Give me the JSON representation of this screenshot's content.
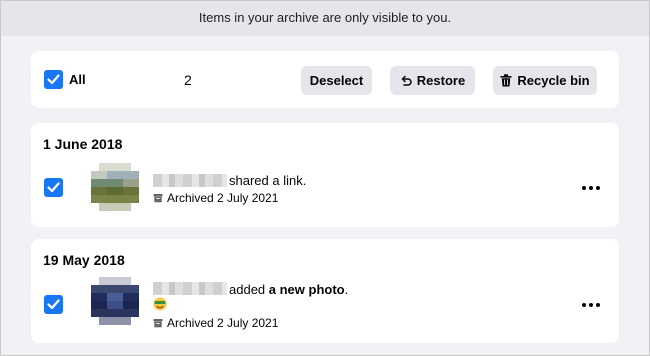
{
  "notice": {
    "text": "Items in your archive are only visible to you."
  },
  "toolbar": {
    "select_all_label": "All",
    "selected_count": "2",
    "deselect_label": "Deselect",
    "restore_label": "Restore",
    "recycle_label": "Recycle bin"
  },
  "posts": [
    {
      "date": "1 June 2018",
      "action_plain": "shared a link.",
      "action_bold": "",
      "archived": "Archived 2 July 2021",
      "checked": true,
      "avatar_icon": "blurred-photo-icon"
    },
    {
      "date": "19 May 2018",
      "action_plain": "added ",
      "action_bold": "a new photo",
      "action_tail": ".",
      "emoji_icon": "smiling-face-emoji-icon",
      "archived": "Archived 2 July 2021",
      "checked": true,
      "avatar_icon": "blurred-photo-icon"
    }
  ],
  "colors": {
    "accent": "#1877f2",
    "background": "#f0f2f5",
    "notice_bg": "#e4e6eb",
    "button_bg": "#e4e6eb"
  }
}
